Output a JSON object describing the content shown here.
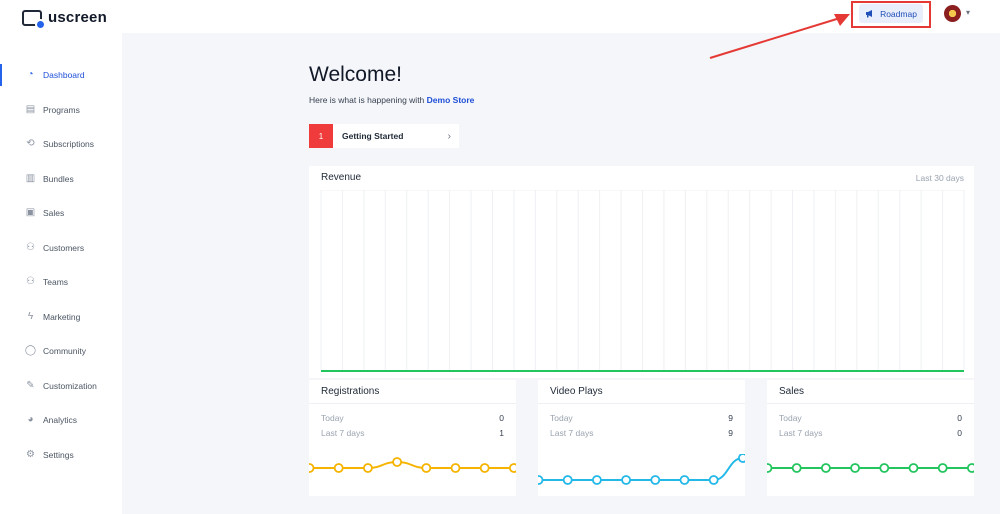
{
  "app": {
    "name": "uscreen"
  },
  "header": {
    "roadmap_label": "Roadmap"
  },
  "sidebar": {
    "items": [
      {
        "label": "Dashboard",
        "icon": "dashboard-icon",
        "active": true
      },
      {
        "label": "Programs",
        "icon": "programs-icon"
      },
      {
        "label": "Subscriptions",
        "icon": "subscriptions-icon"
      },
      {
        "label": "Bundles",
        "icon": "bundles-icon"
      },
      {
        "label": "Sales",
        "icon": "sales-icon"
      },
      {
        "label": "Customers",
        "icon": "customers-icon"
      },
      {
        "label": "Teams",
        "icon": "teams-icon"
      },
      {
        "label": "Marketing",
        "icon": "marketing-icon"
      },
      {
        "label": "Community",
        "icon": "community-icon"
      },
      {
        "label": "Customization",
        "icon": "customization-icon"
      },
      {
        "label": "Analytics",
        "icon": "analytics-icon"
      },
      {
        "label": "Settings",
        "icon": "settings-icon"
      }
    ]
  },
  "main": {
    "title": "Welcome!",
    "subtitle_prefix": "Here is what is happening with",
    "store_name": "Demo Store",
    "getting_started": {
      "step": "1",
      "label": "Getting Started"
    }
  },
  "revenue": {
    "title": "Revenue",
    "range": "Last 30 days",
    "line_color": "#22c55e"
  },
  "cards": [
    {
      "title": "Registrations",
      "today_label": "Today",
      "today_value": "0",
      "week_label": "Last 7 days",
      "week_value": "1",
      "color": "#f5b400",
      "values": [
        0,
        0,
        0,
        1,
        0,
        0,
        0,
        0
      ]
    },
    {
      "title": "Video Plays",
      "today_label": "Today",
      "today_value": "9",
      "week_label": "Last 7 days",
      "week_value": "9",
      "color": "#22b8e8",
      "values": [
        0,
        0,
        0,
        0,
        0,
        0,
        0,
        9
      ]
    },
    {
      "title": "Sales",
      "today_label": "Today",
      "today_value": "0",
      "week_label": "Last 7 days",
      "week_value": "0",
      "color": "#22c55e",
      "values": [
        0,
        0,
        0,
        0,
        0,
        0,
        0,
        0
      ]
    }
  ],
  "colors": {
    "accent": "#2563eb",
    "alert": "#ef3b3b",
    "annotation": "#e53935"
  }
}
